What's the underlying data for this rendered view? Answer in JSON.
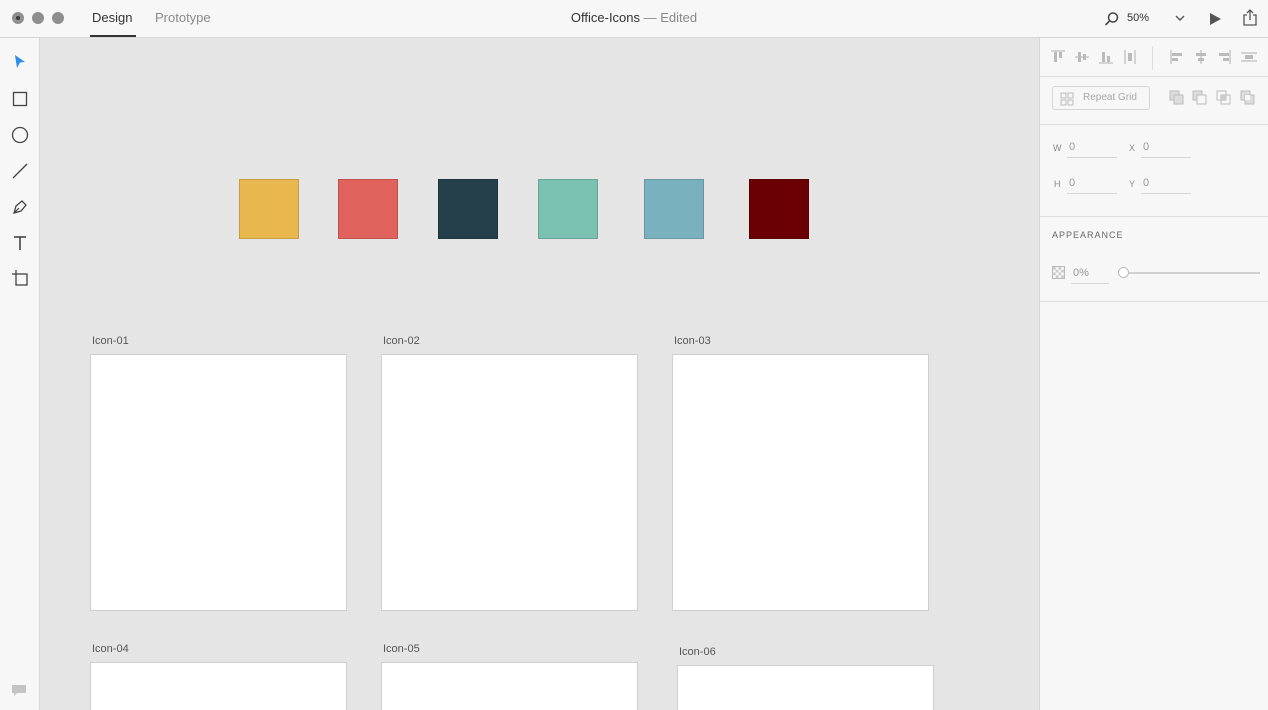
{
  "titlebar": {
    "tabs": [
      {
        "label": "Design",
        "active": true
      },
      {
        "label": "Prototype",
        "active": false
      }
    ],
    "document_name": "Office-Icons",
    "document_status": " — Edited",
    "zoom": "50%"
  },
  "toolbar": {
    "tools": [
      "select-tool",
      "rectangle-tool",
      "ellipse-tool",
      "line-tool",
      "pen-tool",
      "text-tool",
      "artboard-tool"
    ],
    "accent": "#2d8ceb"
  },
  "canvas": {
    "swatches": [
      "#e8b84e",
      "#df625d",
      "#25404a",
      "#7bc1b1",
      "#7ab1be",
      "#6a0003"
    ],
    "artboards": [
      {
        "label": "Icon-01"
      },
      {
        "label": "Icon-02"
      },
      {
        "label": "Icon-03"
      },
      {
        "label": "Icon-04"
      },
      {
        "label": "Icon-05"
      },
      {
        "label": "Icon-06"
      }
    ]
  },
  "panel": {
    "repeat_grid_label": "Repeat Grid",
    "fields": {
      "w": {
        "label": "W",
        "value": "0"
      },
      "x": {
        "label": "X",
        "value": "0"
      },
      "h": {
        "label": "H",
        "value": "0"
      },
      "y": {
        "label": "Y",
        "value": "0"
      }
    },
    "appearance_title": "APPEARANCE",
    "opacity": "0%"
  }
}
